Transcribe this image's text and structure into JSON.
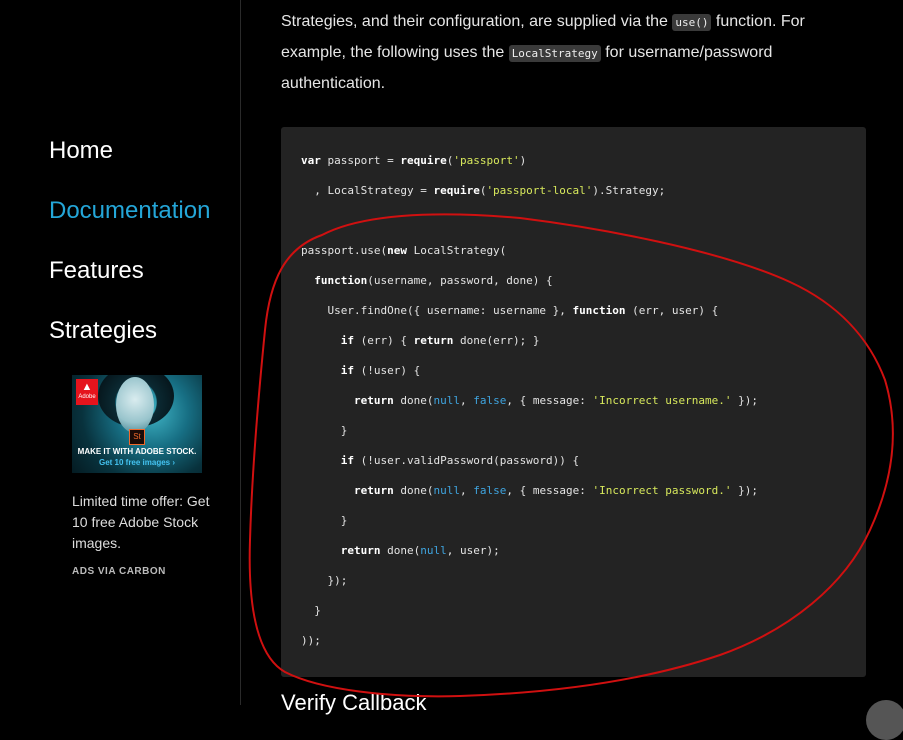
{
  "sidebar": {
    "nav": [
      {
        "label": "Home"
      },
      {
        "label": "Documentation",
        "active": true
      },
      {
        "label": "Features"
      },
      {
        "label": "Strategies"
      }
    ],
    "ad": {
      "brand": "Adobe",
      "product_badge": "St",
      "headline": "MAKE IT WITH ADOBE STOCK.",
      "cta": "Get 10 free images ›",
      "text": "Limited time offer: Get 10 free Adobe Stock images.",
      "via": "ADS VIA CARBON"
    }
  },
  "content": {
    "intro": {
      "part1": "Strategies, and their configuration, are supplied via the ",
      "code1": "use()",
      "part2": " function. For example, the following uses the ",
      "code2": "LocalStrategy",
      "part3": " for username/password authentication."
    },
    "code": {
      "l1_kw1": "var",
      "l1_t1": " passport = ",
      "l1_kw2": "require",
      "l1_t2": "(",
      "l1_s1": "'passport'",
      "l1_t3": ")",
      "l2_t1": "  , LocalStrategy = ",
      "l2_kw1": "require",
      "l2_t2": "(",
      "l2_s1": "'passport-local'",
      "l2_t3": ").Strategy;",
      "l4_t1": "passport.use(",
      "l4_kw1": "new",
      "l4_t2": " LocalStrategy(",
      "l5_t1": "  ",
      "l5_kw1": "function",
      "l5_t2": "(username, password, done) {",
      "l6_t1": "    User.findOne({ username: username }, ",
      "l6_kw1": "function",
      "l6_t2": " (err, user) {",
      "l7_t1": "      ",
      "l7_kw1": "if",
      "l7_t2": " (err) { ",
      "l7_kw2": "return",
      "l7_t3": " done(err); }",
      "l8_t1": "      ",
      "l8_kw1": "if",
      "l8_t2": " (!user) {",
      "l9_t1": "        ",
      "l9_kw1": "return",
      "l9_t2": " done(",
      "l9_n1": "null",
      "l9_t3": ", ",
      "l9_n2": "false",
      "l9_t4": ", { message: ",
      "l9_s1": "'Incorrect username.'",
      "l9_t5": " });",
      "l10_t1": "      }",
      "l11_t1": "      ",
      "l11_kw1": "if",
      "l11_t2": " (!user.validPassword(password)) {",
      "l12_t1": "        ",
      "l12_kw1": "return",
      "l12_t2": " done(",
      "l12_n1": "null",
      "l12_t3": ", ",
      "l12_n2": "false",
      "l12_t4": ", { message: ",
      "l12_s1": "'Incorrect password.'",
      "l12_t5": " });",
      "l13_t1": "      }",
      "l14_t1": "      ",
      "l14_kw1": "return",
      "l14_t2": " done(",
      "l14_n1": "null",
      "l14_t3": ", user);",
      "l15_t1": "    });",
      "l16_t1": "  }",
      "l17_t1": "));"
    },
    "next_heading": "Verify Callback"
  },
  "colors": {
    "accent": "#24a6d8",
    "string": "#d7e85c",
    "literal": "#3fa5e0",
    "annotation": "#d01010"
  }
}
